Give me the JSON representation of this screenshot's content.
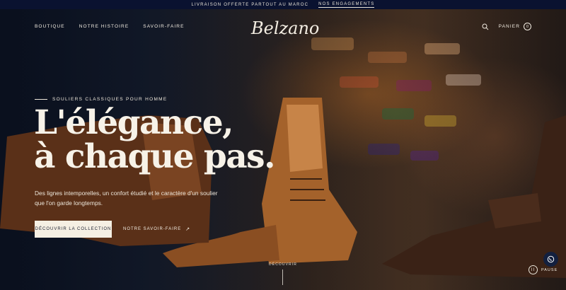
{
  "announcement": {
    "text": "LIVRAISON OFFERTE PARTOUT AU MAROC",
    "link": "NOS ENGAGEMENTS"
  },
  "nav": {
    "items": [
      {
        "label": "BOUTIQUE"
      },
      {
        "label": "NOTRE HISTOIRE"
      },
      {
        "label": "SAVOIR-FAIRE"
      }
    ],
    "logo": "Belzano",
    "cart_label": "PANIER",
    "cart_count": "0"
  },
  "hero": {
    "eyebrow": "SOULIERS CLASSIQUES POUR HOMME",
    "headline_line1": "L'élégance,",
    "headline_line2": "à chaque pas.",
    "subtext": "Des lignes intemporelles, un confort étudié et le caractère d'un soulier que l'on garde longtemps.",
    "cta_primary": "DÉCOUVRIR LA COLLECTION",
    "cta_secondary": "NOTRE SAVOIR-FAIRE",
    "cta_secondary_icon": "↗"
  },
  "footer_controls": {
    "discover": "DÉCOUVRIR",
    "pause": "PAUSE",
    "pause_icon": "II"
  },
  "colors": {
    "announcement_bg": "#0a1230",
    "cream": "#f5efe3",
    "ink": "#1b2030",
    "leather": "#a4622b"
  },
  "icons": [
    "search-icon",
    "arrow-up-right-icon",
    "pause-icon",
    "whatsapp-icon"
  ]
}
